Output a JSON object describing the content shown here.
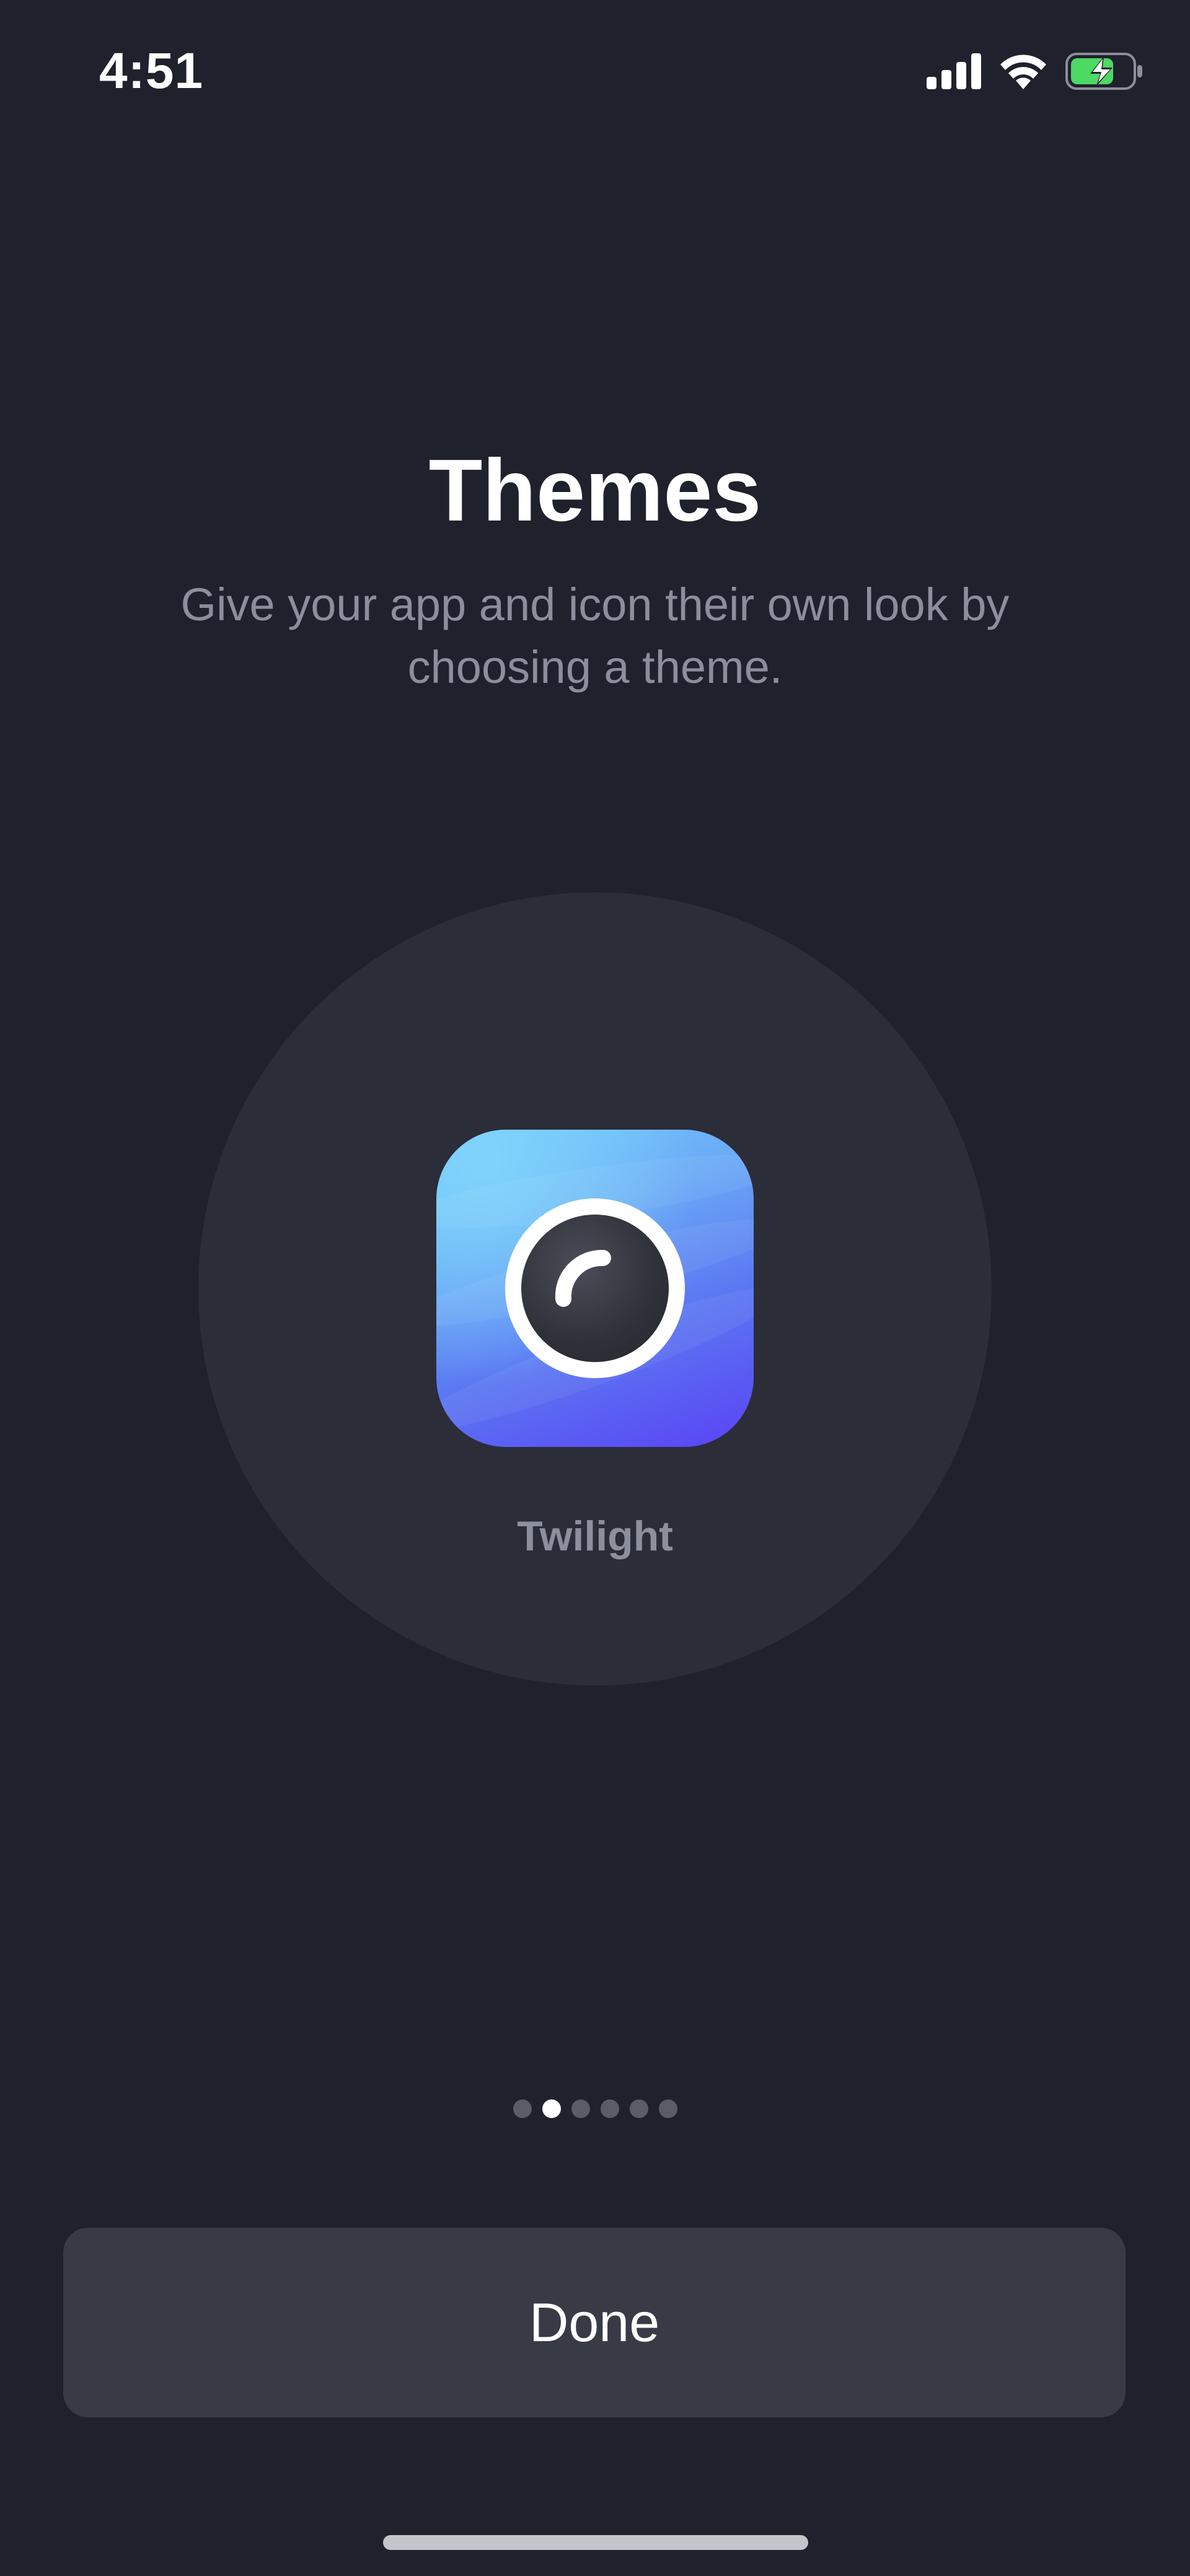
{
  "status_bar": {
    "time": "4:51",
    "icons": [
      "cellular-signal-icon",
      "wifi-icon",
      "battery-charging-icon"
    ],
    "battery_color": "#4cd964"
  },
  "onboarding": {
    "title": "Themes",
    "subtitle": "Give your app and icon their own look by choosing a theme.",
    "theme": {
      "name": "Twilight",
      "icon": "camera-lens-app-icon",
      "gradient_colors": [
        "#74cdfb",
        "#5b78f2",
        "#5a43f4"
      ]
    },
    "pager": {
      "total_pages": 6,
      "current_page": 2
    }
  },
  "actions": {
    "done_label": "Done"
  },
  "colors": {
    "background": "#1f212c",
    "circle": "#2b2d39",
    "button": "#383a46",
    "subtitle_text": "#8b8e9c"
  }
}
